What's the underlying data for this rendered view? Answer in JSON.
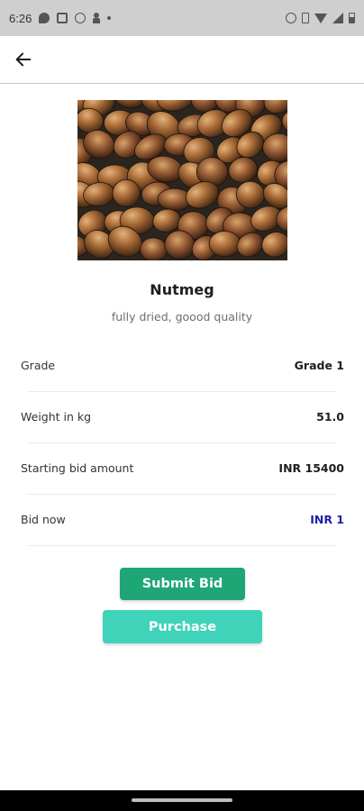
{
  "status_bar": {
    "time": "6:26",
    "icons": [
      "chat-icon",
      "square-app-icon",
      "check-circle-icon",
      "person-icon",
      "dot-icon",
      "alarm-icon",
      "vibrate-icon",
      "wifi-icon",
      "signal-icon",
      "battery-icon"
    ]
  },
  "app_bar": {
    "back_icon": "arrow-left-icon"
  },
  "product": {
    "image": "nutmeg-photo",
    "name": "Nutmeg",
    "description": "fully dried, goood quality"
  },
  "details": [
    {
      "label": "Grade",
      "value": "Grade 1"
    },
    {
      "label": "Weight in kg",
      "value": "51.0"
    },
    {
      "label": "Starting bid amount",
      "value": "INR 15400"
    },
    {
      "label": "Bid now",
      "value": "INR 1"
    }
  ],
  "actions": {
    "submit_label": "Submit Bid",
    "purchase_label": "Purchase"
  },
  "colors": {
    "submit_button": "#1fa677",
    "purchase_button": "#3fd3b9",
    "bid_value": "#1f1fa8",
    "status_bar_bg": "#cfcfcf"
  }
}
